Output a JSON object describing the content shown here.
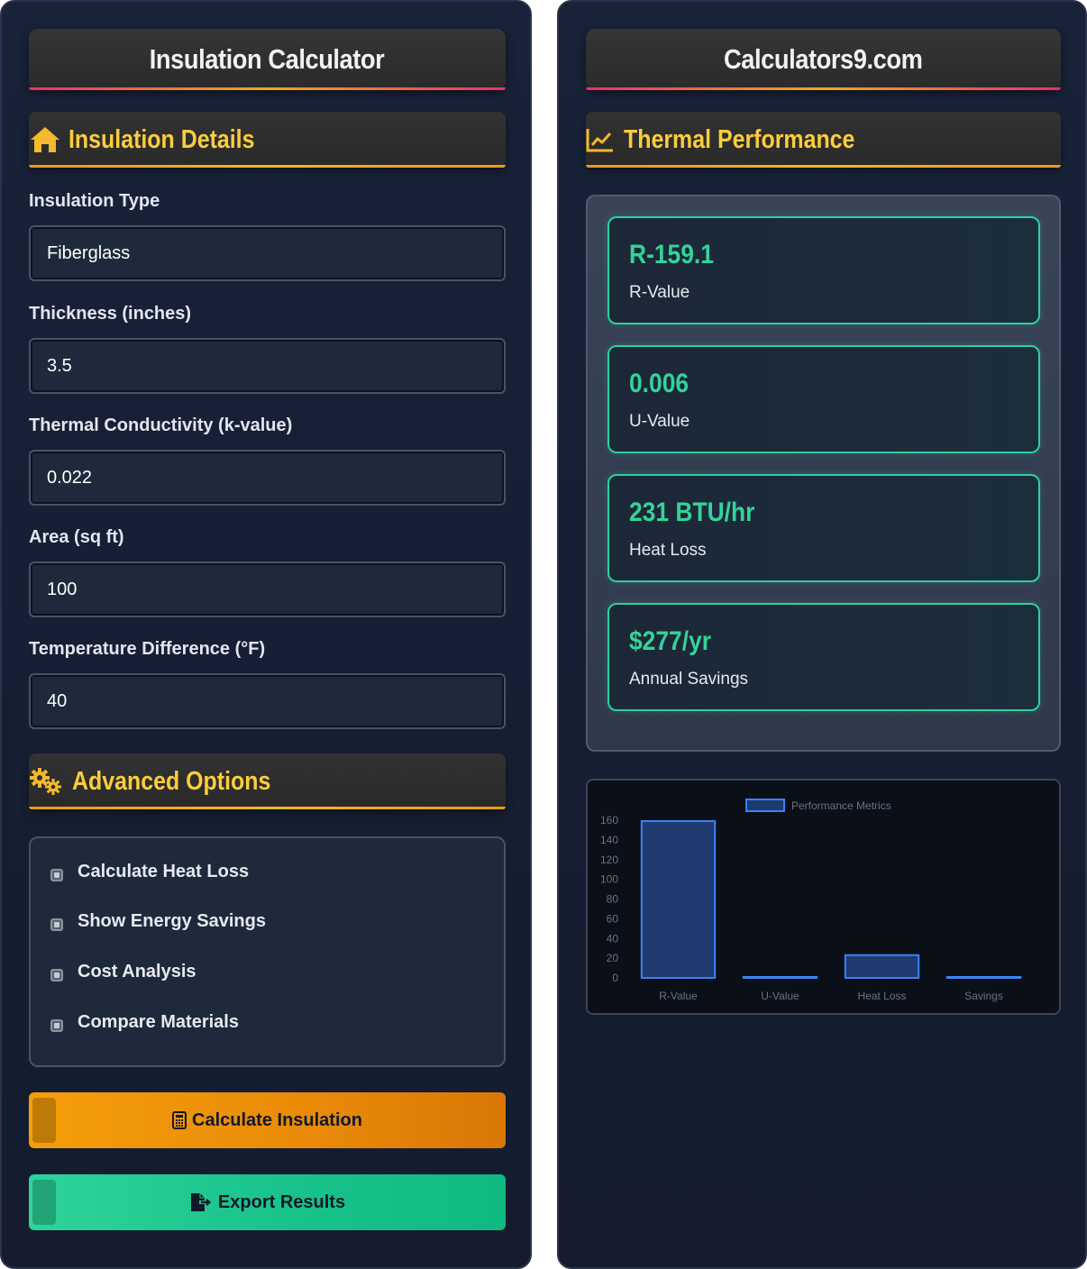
{
  "left": {
    "title": "Insulation Calculator",
    "details_heading": "Insulation Details",
    "fields": [
      {
        "label": "Insulation Type",
        "value": "Fiberglass"
      },
      {
        "label": "Thickness (inches)",
        "value": "3.5"
      },
      {
        "label": "Thermal Conductivity (k-value)",
        "value": "0.022"
      },
      {
        "label": "Area (sq ft)",
        "value": "100"
      },
      {
        "label": "Temperature Difference (°F)",
        "value": "40"
      }
    ],
    "advanced_heading": "Advanced Options",
    "options": [
      {
        "label": "Calculate Heat Loss",
        "checked": true
      },
      {
        "label": "Show Energy Savings",
        "checked": true
      },
      {
        "label": "Cost Analysis",
        "checked": true
      },
      {
        "label": "Compare Materials",
        "checked": true
      }
    ],
    "calculate_label": "Calculate Insulation",
    "export_label": "Export Results"
  },
  "right": {
    "title": "Calculators9.com",
    "performance_heading": "Thermal Performance",
    "metrics": [
      {
        "value": "R-159.1",
        "label": "R-Value"
      },
      {
        "value": "0.006",
        "label": "U-Value"
      },
      {
        "value": "231 BTU/hr",
        "label": "Heat Loss"
      },
      {
        "value": "$277/yr",
        "label": "Annual Savings"
      }
    ]
  },
  "colors": {
    "accent_yellow": "#fbcd3c",
    "accent_green": "#34d399",
    "button_orange": "#f59e0b",
    "button_green": "#10b981",
    "bar_fill": "#1e3a6e",
    "bar_stroke": "#3b82f6"
  },
  "chart_data": {
    "type": "bar",
    "categories": [
      "R-Value",
      "U-Value",
      "Heat Loss",
      "Savings"
    ],
    "series": [
      {
        "name": "Performance Metrics",
        "values": [
          159.1,
          0.006,
          23.1,
          0.6
        ]
      }
    ],
    "yticks": [
      0,
      20,
      40,
      60,
      80,
      100,
      120,
      140,
      160
    ],
    "ylim": [
      0,
      160
    ],
    "legend": "top"
  }
}
